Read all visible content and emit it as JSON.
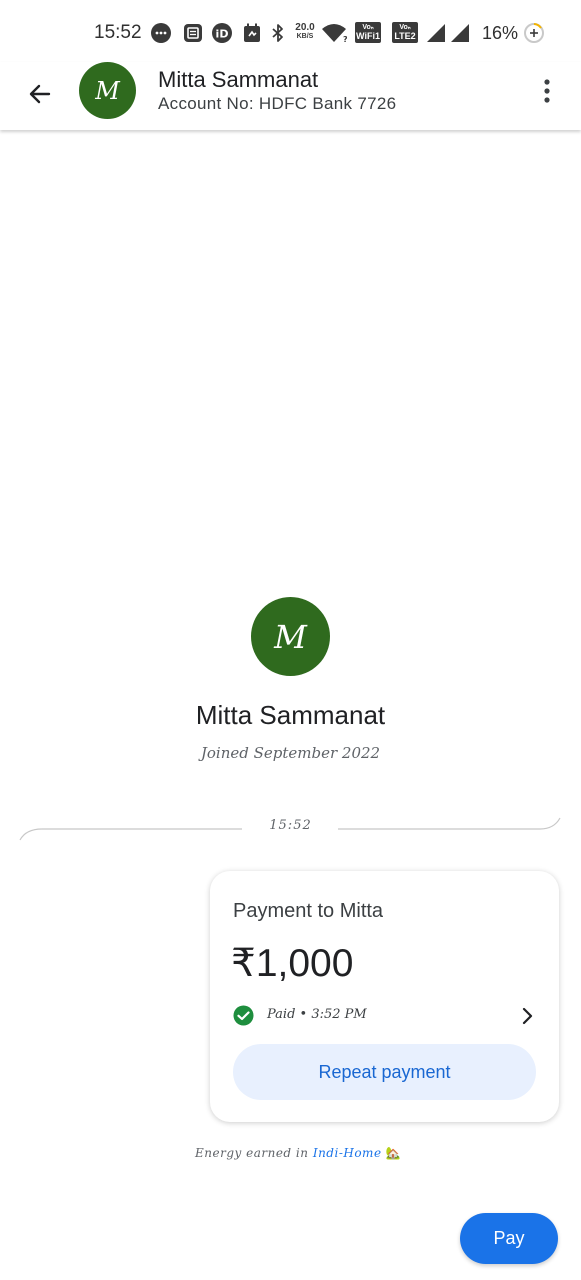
{
  "status_bar": {
    "time": "15:52",
    "net_speed_value": "20.0",
    "net_speed_unit": "KB/S",
    "wifi_badge_top": "Voₙ",
    "wifi_badge_bottom": "WiFi1",
    "lte_badge_top": "Voₙ",
    "lte_badge_bottom": "LTE2",
    "battery": "16%"
  },
  "header": {
    "avatar_initial": "M",
    "name": "Mitta Sammanat",
    "account": "Account No: HDFC Bank 7726"
  },
  "profile": {
    "avatar_initial": "M",
    "name": "Mitta Sammanat",
    "joined": "Joined September 2022"
  },
  "divider": {
    "time": "15:52"
  },
  "payment_card": {
    "title": "Payment to Mitta",
    "amount": "₹1,000",
    "status": "Paid • 3:52 PM",
    "repeat_label": "Repeat payment"
  },
  "energy": {
    "prefix": "Energy earned in",
    "link": "Indi-Home",
    "emoji": "🏡"
  },
  "pay_button": {
    "label": "Pay"
  },
  "colors": {
    "avatar_bg": "#2f6a1e",
    "accent": "#1a73e8",
    "repeat_bg": "#e8f0fe",
    "check_green": "#1e8e3e"
  }
}
